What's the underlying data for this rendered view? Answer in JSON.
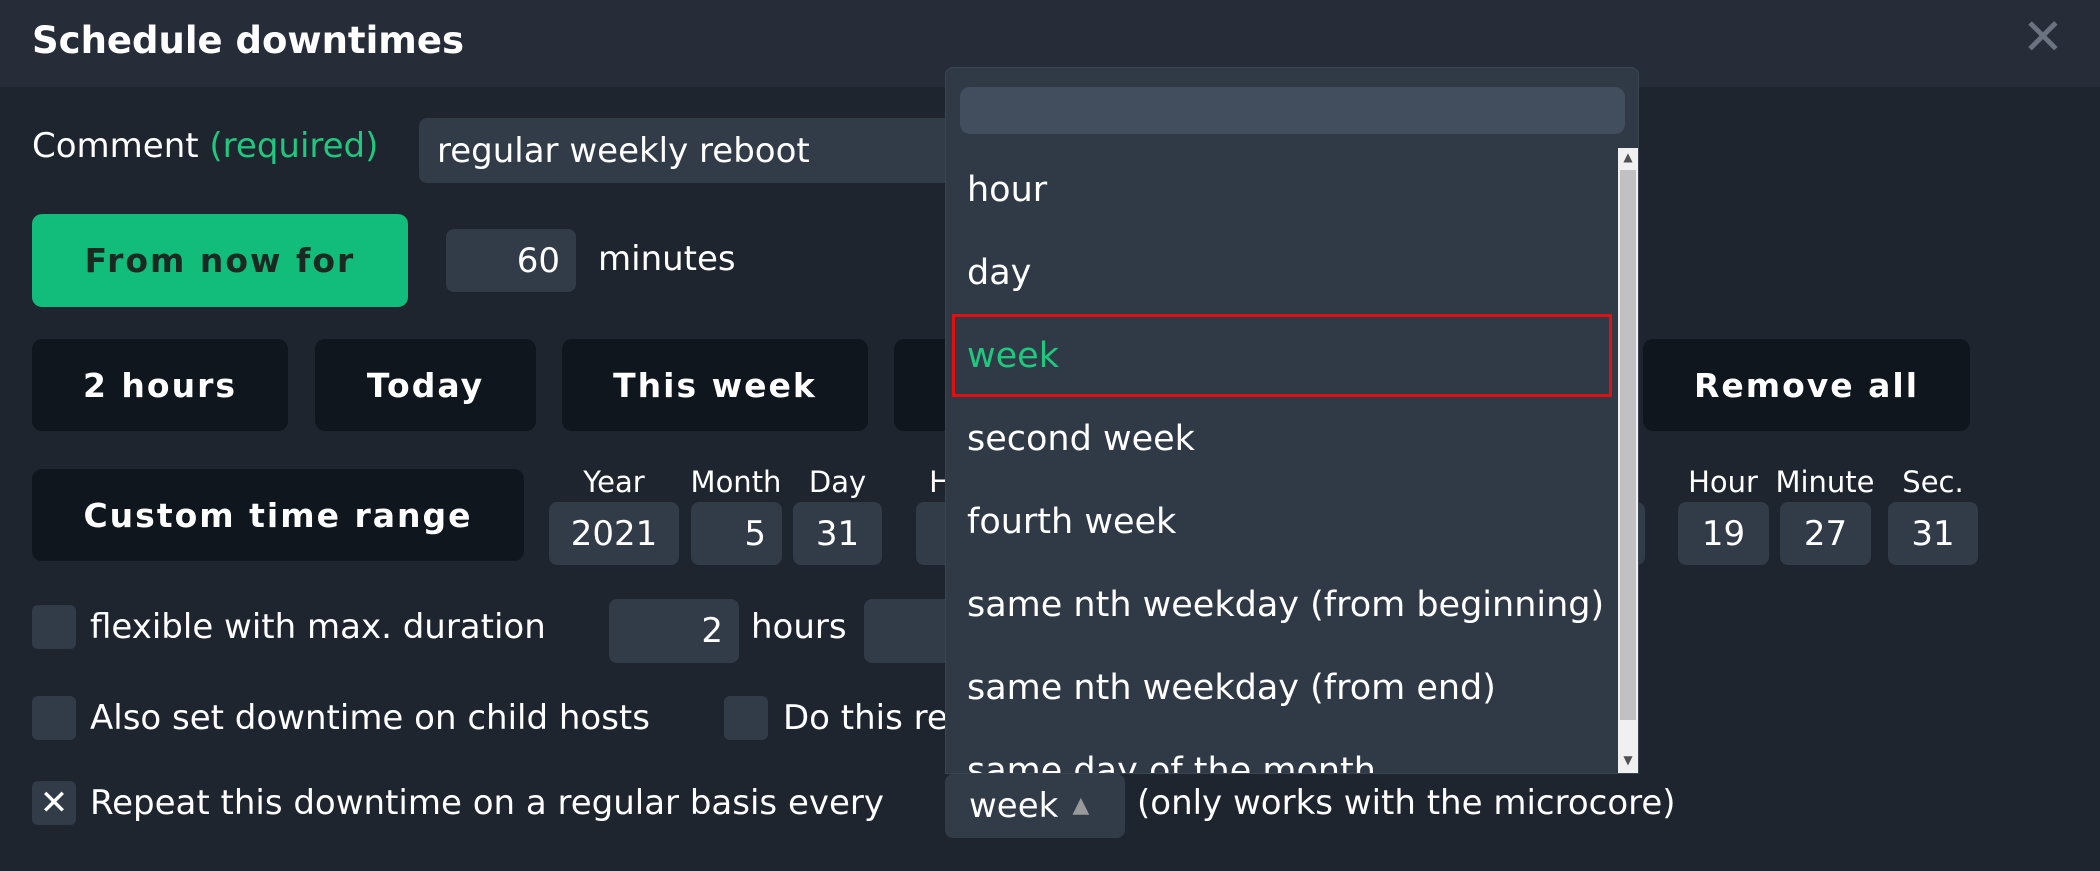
{
  "header": {
    "title": "Schedule downtimes",
    "close_icon": "close-icon"
  },
  "comment": {
    "label": "Comment",
    "required": "(required)",
    "value": "regular weekly reboot"
  },
  "from_now": {
    "button": "From now for",
    "value": "60",
    "unit": "minutes"
  },
  "quick_buttons": [
    "2 hours",
    "Today",
    "This week",
    "Remove all"
  ],
  "custom": {
    "button": "Custom time range",
    "start": {
      "year_label": "Year",
      "month_label": "Month",
      "day_label": "Day",
      "hour_label_partial": "H",
      "year": "2021",
      "month": "5",
      "day": "31"
    },
    "end": {
      "hour_label": "Hour",
      "minute_label": "Minute",
      "sec_label": "Sec.",
      "hour": "19",
      "minute": "27",
      "sec": "31"
    }
  },
  "flexible": {
    "label": "flexible with max. duration",
    "hours": "2",
    "hours_unit": "hours",
    "checked": false
  },
  "child_hosts": {
    "label": "Also set downtime on child hosts",
    "checked": false
  },
  "do_this": {
    "label_partial": "Do this re",
    "checked": false
  },
  "repeat": {
    "label": "Repeat this downtime on a regular basis every",
    "checked": true,
    "selected": "week",
    "note": "(only works with the microcore)"
  },
  "dropdown": {
    "search_value": "",
    "options": [
      "hour",
      "day",
      "week",
      "second week",
      "fourth week",
      "same nth weekday (from beginning)",
      "same nth weekday (from end)",
      "same day of the month"
    ],
    "selected_index": 2
  },
  "colors": {
    "accent": "#12bd7c",
    "highlight_border": "#e01010",
    "background": "#1f252e"
  }
}
